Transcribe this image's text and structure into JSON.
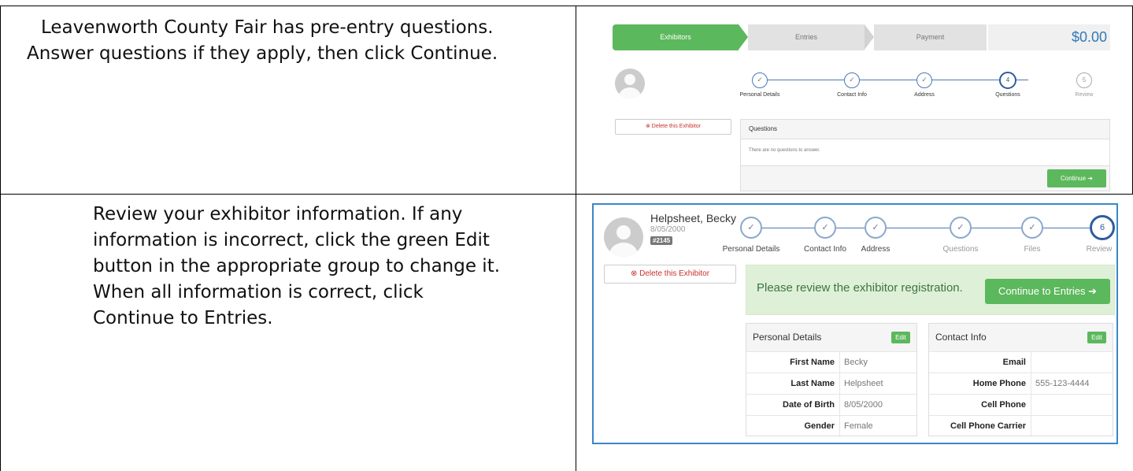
{
  "row1": {
    "instruction_lines": [
      "Leavenworth County Fair has pre-entry questions.",
      "Answer questions if they apply, then click Continue."
    ],
    "wizard": {
      "exhibitors": "Exhibitors",
      "entries": "Entries",
      "payment": "Payment",
      "total": "$0.00"
    },
    "steps": [
      {
        "label": "Personal Details",
        "mark": "✓"
      },
      {
        "label": "Contact Info",
        "mark": "✓"
      },
      {
        "label": "Address",
        "mark": "✓"
      },
      {
        "label": "Questions",
        "mark": "4"
      },
      {
        "label": "Review",
        "mark": "5"
      }
    ],
    "delete_label": "Delete this Exhibitor",
    "panel_title": "Questions",
    "panel_body": "There are no questions to answer.",
    "continue_label": "Continue"
  },
  "row2": {
    "instruction_lines": [
      "Review your exhibitor information. If any",
      "information is incorrect, click the green Edit",
      "button in the appropriate group to change it.",
      "When all information is correct, click",
      "Continue to Entries."
    ],
    "exhibitor": {
      "name": "Helpsheet, Becky",
      "dob": "8/05/2000",
      "badge": "#2145"
    },
    "steps": [
      {
        "label": "Personal Details",
        "mark": "✓"
      },
      {
        "label": "Contact Info",
        "mark": "✓"
      },
      {
        "label": "Address",
        "mark": "✓"
      },
      {
        "label": "Questions",
        "mark": "✓"
      },
      {
        "label": "Files",
        "mark": "✓"
      },
      {
        "label": "Review",
        "mark": "6"
      }
    ],
    "delete_label": "Delete this Exhibitor",
    "review_message": "Please review the exhibitor registration.",
    "continue_entries_label": "Continue to Entries",
    "personal": {
      "title": "Personal Details",
      "edit": "Edit",
      "rows": [
        {
          "label": "First Name",
          "value": "Becky"
        },
        {
          "label": "Last Name",
          "value": "Helpsheet"
        },
        {
          "label": "Date of Birth",
          "value": "8/05/2000"
        },
        {
          "label": "Gender",
          "value": "Female"
        }
      ]
    },
    "contact": {
      "title": "Contact Info",
      "edit": "Edit",
      "rows": [
        {
          "label": "Email",
          "value": ""
        },
        {
          "label": "Home Phone",
          "value": "555-123-4444"
        },
        {
          "label": "Cell Phone",
          "value": ""
        },
        {
          "label": "Cell Phone Carrier",
          "value": ""
        }
      ]
    }
  },
  "colors": {
    "green": "#5cb85c",
    "blue": "#337ab7",
    "highlight_border": "#3a87c8"
  }
}
